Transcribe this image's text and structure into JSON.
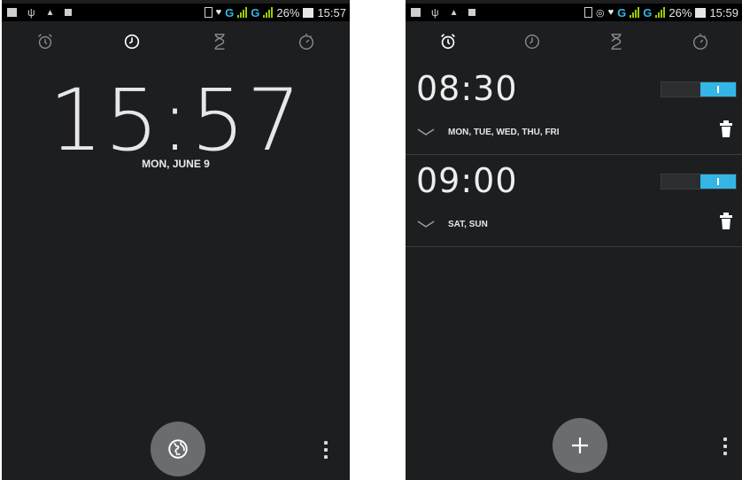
{
  "status_bar": {
    "network_type": "G",
    "battery": "26%",
    "time_left": "15:57",
    "time_right": "15:59"
  },
  "tabs": [
    {
      "name": "alarm",
      "icon": "alarm-clock-icon"
    },
    {
      "name": "clock",
      "icon": "clock-icon"
    },
    {
      "name": "timer",
      "icon": "hourglass-icon"
    },
    {
      "name": "stopwatch",
      "icon": "stopwatch-icon"
    }
  ],
  "clock_screen": {
    "time": "15:57",
    "date": "MON, JUNE 9",
    "world_button_icon": "globe-icon",
    "menu_icon": "overflow-menu-icon"
  },
  "alarm_screen": {
    "alarms": [
      {
        "time": "08:30",
        "days": "MON, TUE, WED, THU, FRI",
        "enabled": true
      },
      {
        "time": "09:00",
        "days": "SAT, SUN",
        "enabled": true
      }
    ],
    "add_button_icon": "plus-icon",
    "menu_icon": "overflow-menu-icon"
  },
  "colors": {
    "background": "#1c1e20",
    "accent": "#33b5e5",
    "button": "#6a6c6e"
  }
}
